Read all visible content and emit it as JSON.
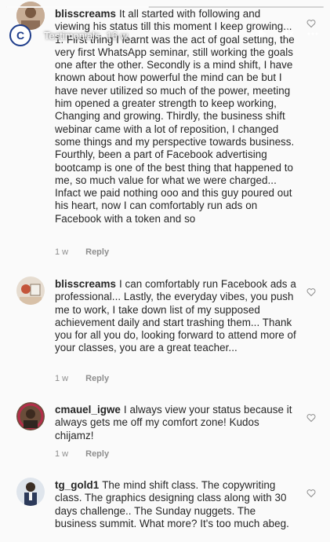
{
  "story": {
    "account": "Testimonials",
    "time": "16 w",
    "progress": 0.45
  },
  "comments": [
    {
      "username": "blisscreams",
      "text": "It all started with following and viewing his status till this moment I keep growing... 1. First thing I learnt was the act of goal setting, the very first WhatsApp seminar, still working the goals one after the other. Secondly is a mind shift, I have known about how powerful the mind can be but I have never utilized so much of the power, meeting him opened a greater strength to keep working, Changing and growing. Thirdly, the business shift webinar came with a lot of reposition, I changed some things and my perspective towards business. Fourthly, been a part of Facebook advertising bootcamp is one of the best thing that happened to me, so much value for what we were charged... Infact we paid nothing ooo and this guy poured out his heart, now I can comfortably run ads on Facebook with a token and so",
      "age": "1 w",
      "reply": "Reply"
    },
    {
      "username": "blisscreams",
      "text": "I can comfortably run Facebook ads a professional... Lastly, the everyday vibes, you push me to work, I take down list of my supposed achievement daily and start trashing them... Thank you for all you do, looking forward to attend more of your classes, you are a great teacher...",
      "age": "1 w",
      "reply": "Reply"
    },
    {
      "username": "cmauel_igwe",
      "text": "I always view your status because it always gets me off my comfort zone! Kudos chijamz!",
      "age": "1 w",
      "reply": "Reply"
    },
    {
      "username": "tg_gold1",
      "text": "The mind shift class. The copywriting class. The graphics designing class along with 30 days challenge.. The Sunday nuggets. The business summit.  What more? It's too much abeg.",
      "age": "",
      "reply": ""
    }
  ],
  "icons": {
    "story_avatar": "c-logo-icon",
    "play": "play-icon",
    "mute": "speaker-muted-icon",
    "more": "more-dots-icon",
    "like": "heart-icon"
  },
  "colors": {
    "text": "#262626",
    "meta": "#8e8e8e",
    "story_brand": "#1d3c8a"
  }
}
